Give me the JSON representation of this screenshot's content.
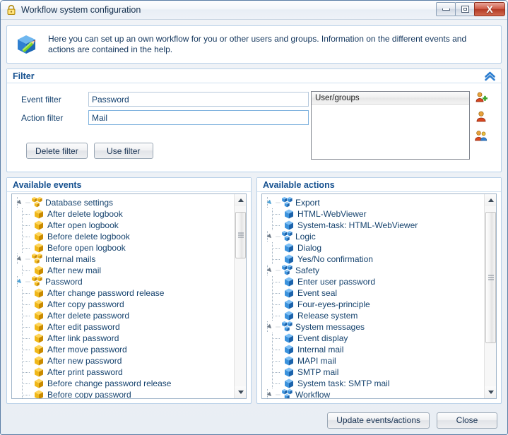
{
  "window": {
    "title": "Workflow system configuration",
    "lock_icon": "lock-icon",
    "minimize_label": "",
    "maximize_label": "",
    "close_label": "X"
  },
  "banner": {
    "icon": "cube-pencil-icon",
    "text": "Here you can set up an own workflow for you or other users and groups. Information on the different events and actions are contained in the help."
  },
  "filter": {
    "title": "Filter",
    "collapse_icon": "chevron-double-up-icon",
    "event_filter_label": "Event filter",
    "event_filter_value": "Password",
    "event_filter_placeholder": "",
    "action_filter_label": "Action filter",
    "action_filter_value": "Mail",
    "action_filter_placeholder": "",
    "delete_filter_label": "Delete filter",
    "use_filter_label": "Use filter",
    "user_groups": {
      "header": "User/groups",
      "rows": [],
      "tools": [
        {
          "name": "add-user-icon"
        },
        {
          "name": "user-icon"
        },
        {
          "name": "user-group-icon"
        }
      ]
    }
  },
  "events_panel": {
    "title": "Available events",
    "cube_color": "#e8a800",
    "nodes": [
      {
        "type": "group",
        "label": "Database settings",
        "highlighted": false
      },
      {
        "type": "leaf",
        "label": "After delete logbook"
      },
      {
        "type": "leaf",
        "label": "After open logbook"
      },
      {
        "type": "leaf",
        "label": "Before delete logbook"
      },
      {
        "type": "leaf",
        "label": "Before open logbook"
      },
      {
        "type": "group",
        "label": "Internal mails",
        "highlighted": false
      },
      {
        "type": "leaf",
        "label": "After new mail"
      },
      {
        "type": "group",
        "label": "Password",
        "highlighted": true
      },
      {
        "type": "leaf",
        "label": "After change password release"
      },
      {
        "type": "leaf",
        "label": "After copy password"
      },
      {
        "type": "leaf",
        "label": "After delete password"
      },
      {
        "type": "leaf",
        "label": "After edit password"
      },
      {
        "type": "leaf",
        "label": "After link password"
      },
      {
        "type": "leaf",
        "label": "After move password"
      },
      {
        "type": "leaf",
        "label": "After new password"
      },
      {
        "type": "leaf",
        "label": "After print password"
      },
      {
        "type": "leaf",
        "label": "Before change password release"
      },
      {
        "type": "leaf",
        "label": "Before copy password"
      }
    ],
    "scrollbar": {
      "thumb_top_pct": 3,
      "thumb_height_pct": 26
    }
  },
  "actions_panel": {
    "title": "Available actions",
    "cube_color": "#2f7fd0",
    "nodes": [
      {
        "type": "group",
        "label": "Export",
        "highlighted": true
      },
      {
        "type": "leaf",
        "label": "HTML-WebViewer"
      },
      {
        "type": "leaf",
        "label": "System-task: HTML-WebViewer"
      },
      {
        "type": "group",
        "label": "Logic",
        "highlighted": false
      },
      {
        "type": "leaf",
        "label": "Dialog"
      },
      {
        "type": "leaf",
        "label": "Yes/No confirmation"
      },
      {
        "type": "group",
        "label": "Safety",
        "highlighted": false
      },
      {
        "type": "leaf",
        "label": "Enter user password"
      },
      {
        "type": "leaf",
        "label": "Event seal"
      },
      {
        "type": "leaf",
        "label": "Four-eyes-principle"
      },
      {
        "type": "leaf",
        "label": "Release system"
      },
      {
        "type": "group",
        "label": "System messages",
        "highlighted": false
      },
      {
        "type": "leaf",
        "label": "Event display"
      },
      {
        "type": "leaf",
        "label": "Internal mail"
      },
      {
        "type": "leaf",
        "label": "MAPI mail"
      },
      {
        "type": "leaf",
        "label": "SMTP mail"
      },
      {
        "type": "leaf",
        "label": "System task: SMTP mail"
      },
      {
        "type": "group",
        "label": "Workflow",
        "highlighted": false
      }
    ],
    "scrollbar": {
      "thumb_top_pct": 3,
      "thumb_height_pct": 73
    }
  },
  "footer": {
    "update_label": "Update events/actions",
    "close_label": "Close"
  }
}
